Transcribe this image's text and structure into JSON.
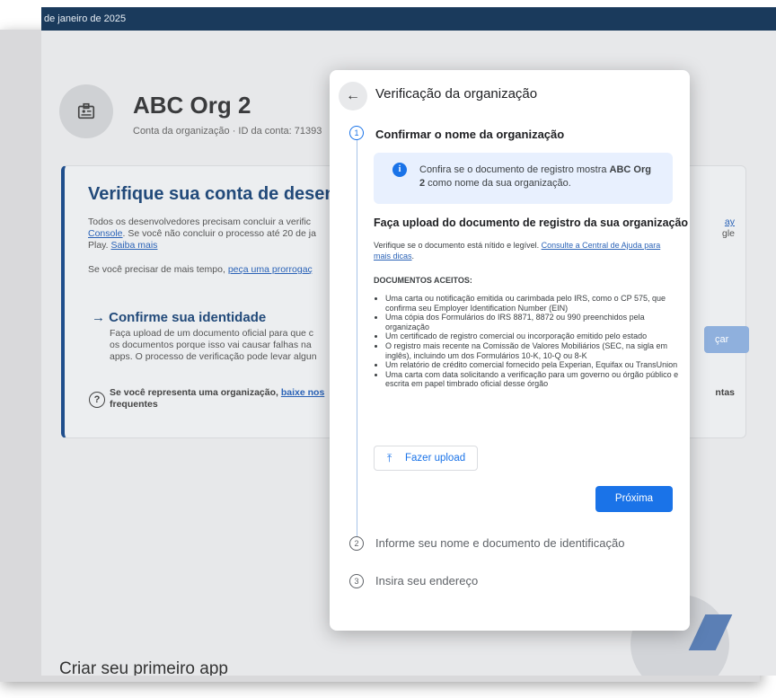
{
  "topbar": {
    "text": "de janeiro de 2025"
  },
  "org": {
    "name": "ABC Org 2",
    "meta": "Conta da organização · ID da conta: 71393"
  },
  "card": {
    "title": "Verifique sua conta de desenvo",
    "line1": "Todos os desenvolvedores precisam concluir a verific",
    "line2_link": "Console",
    "line2_rest": ". Se você não concluir o processo até 20 de ja",
    "line3_text": "Play. ",
    "line3_link": "Saiba mais",
    "line4_text": "Se você precisar de mais tempo, ",
    "line4_link": "peça uma prorrogaç",
    "right1": "ay",
    "right2": "gle",
    "identity_title": "→  Confirme sua identidade",
    "identity1": "Faça upload de um documento oficial para que c",
    "identity2": "os documentos porque isso vai causar falhas na",
    "identity3": "apps. O processo de verificação pode levar algun",
    "start_button": "çar",
    "help_text_bold": "Se você representa uma organização, ",
    "help_link": "baixe nos",
    "help_text2": "frequentes",
    "help_right": "ntas"
  },
  "bottom_title": "Criar seu primeiro app",
  "dialog": {
    "title": "Verificação da organização",
    "step1": {
      "number": "1",
      "label": "Confirmar o nome da organização"
    },
    "info": {
      "pre": "Confira se o documento de registro mostra ",
      "bold": "ABC Org 2",
      "post": " como nome da sua organização."
    },
    "upload_title": "Faça upload do documento de registro da sua organização",
    "upload_help_pre": "Verifique se o documento está nítido e legível. ",
    "upload_help_link": "Consulte a Central de Ajuda para mais dicas",
    "upload_help_post": ".",
    "docs_heading": "DOCUMENTOS ACEITOS:",
    "docs": [
      "Uma carta ou notificação emitida ou carimbada pelo IRS, como o CP 575, que confirma seu Employer Identification Number (EIN)",
      "Uma cópia dos Formulários do IRS 8871, 8872 ou 990 preenchidos pela organização",
      "Um certificado de registro comercial ou incorporação emitido pelo estado",
      "O registro mais recente na Comissão de Valores Mobiliários (SEC, na sigla em inglês), incluindo um dos Formulários 10-K, 10-Q ou 8-K",
      "Um relatório de crédito comercial fornecido pela Experian, Equifax ou TransUnion",
      "Uma carta com data solicitando a verificação para um governo ou órgão público e escrita em papel timbrado oficial desse órgão"
    ],
    "upload_button": "Fazer upload",
    "next_button": "Próxima",
    "step2": {
      "number": "2",
      "label": "Informe seu nome e documento de identificação"
    },
    "step3": {
      "number": "3",
      "label": "Insira seu endereço"
    }
  }
}
